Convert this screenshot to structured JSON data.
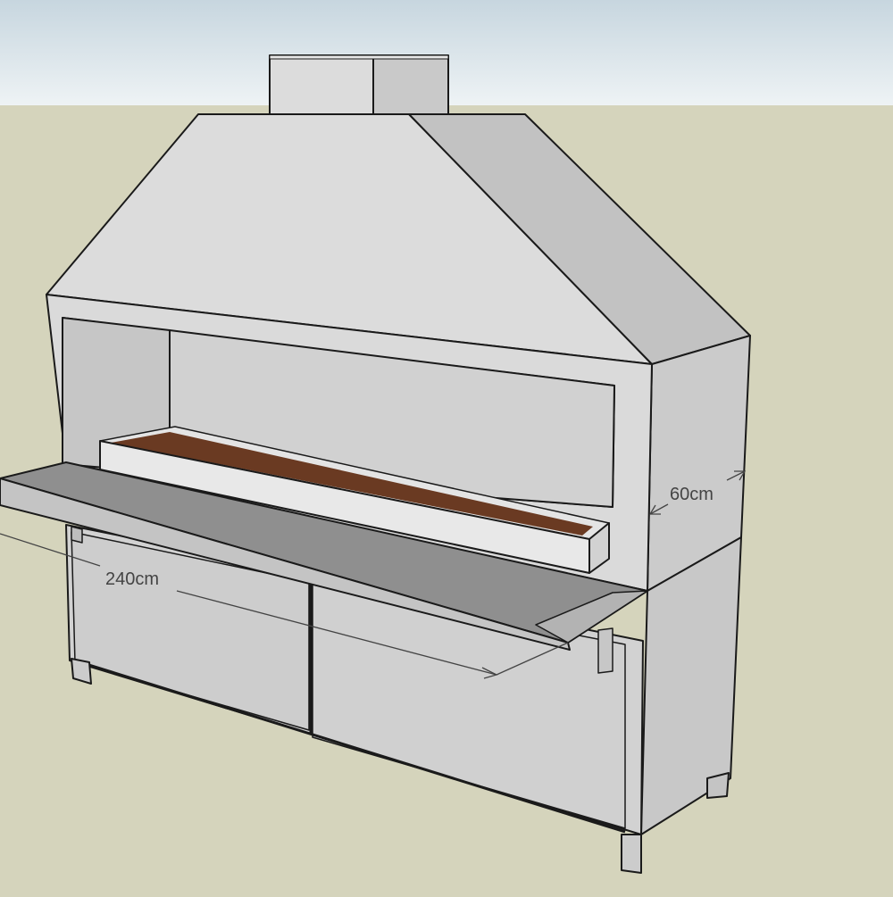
{
  "colors": {
    "ground": "#d5d4bc",
    "sky_top": "#c7d6df",
    "sky_bottom": "#eef3f5",
    "face_light": "#dcdcdc",
    "face_mid": "#cfcfcf",
    "face_dark": "#bcbcbc",
    "counter_top": "#8f8f8f",
    "outline": "#1a1a1a",
    "ember_edge": "#6a3a22",
    "dim_text": "#444444"
  },
  "dimensions": {
    "width_label": "240cm",
    "depth_label": "60cm"
  }
}
